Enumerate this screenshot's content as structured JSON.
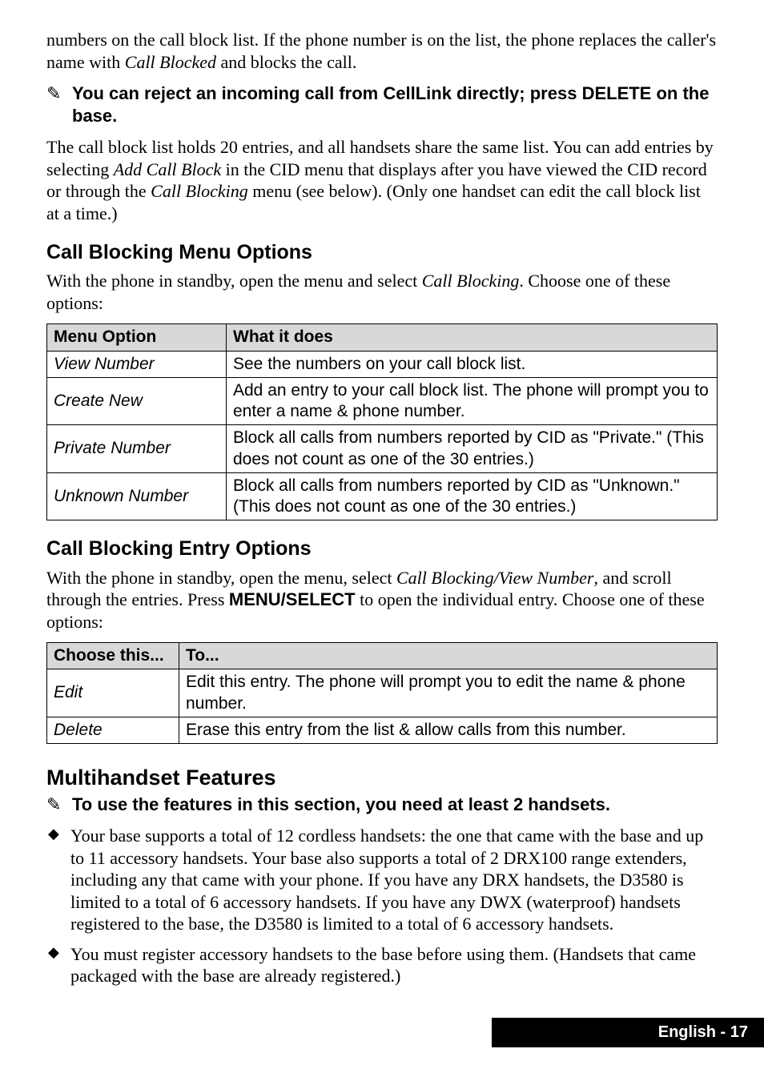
{
  "para1_pre": "numbers on the call block list. If the phone number is on the list, the phone replaces the caller's name with ",
  "para1_em": "Call Blocked",
  "para1_post": " and blocks the call.",
  "note1_icon": "✎",
  "note1_pre": "You can reject an incoming call from CellLink directly; press ",
  "note1_key": "DELETE",
  "note1_post": " on the base.",
  "para2_pre": "The call block list holds 20 entries, and all handsets share the same list. You can add entries by selecting ",
  "para2_em1": "Add Call Block",
  "para2_mid": " in the CID menu that displays after you have viewed the CID record or through the ",
  "para2_em2": "Call Blocking",
  "para2_post": " menu (see below). (Only one handset can edit the call block list at a time.)",
  "h_block_menu": "Call Blocking Menu Options",
  "para3_pre": "With the phone in standby, open the menu and select ",
  "para3_em": "Call Blocking",
  "para3_post": ". Choose one of these options:",
  "table1": {
    "headers": {
      "c1": "Menu Option",
      "c2": "What it does"
    },
    "rows": [
      {
        "opt": "View Number",
        "desc": "See the numbers on your call block list."
      },
      {
        "opt": "Create New",
        "desc": "Add an entry to your call block list. The phone will prompt you to enter a name & phone number."
      },
      {
        "opt": "Private Number",
        "desc": "Block all calls from numbers reported by CID as \"Private.\" (This does not count as one of the 30 entries.)"
      },
      {
        "opt": "Unknown Number",
        "desc": "Block all calls from numbers reported by CID as \"Unknown.\" (This does not count as one of the 30 entries.)"
      }
    ]
  },
  "h_block_entry": "Call Blocking Entry Options",
  "para4_pre": "With the phone in standby, open the menu, select ",
  "para4_em": "Call Blocking/View Number",
  "para4_mid": ", and scroll through the entries. Press ",
  "para4_key": "MENU/SELECT",
  "para4_post": " to open the individual entry. Choose one of these options:",
  "table2": {
    "headers": {
      "c1": "Choose this...",
      "c2": "To..."
    },
    "rows": [
      {
        "opt": "Edit",
        "desc": "Edit this entry. The phone will prompt you to edit the name & phone number."
      },
      {
        "opt": "Delete",
        "desc": "Erase this entry from the list & allow calls from this number."
      }
    ]
  },
  "h_multi": "Multihandset Features",
  "note2_icon": "✎",
  "note2_text": "To use the features in this section, you need at least 2 handsets.",
  "bullets": [
    "Your base supports a total of 12 cordless handsets: the one that came with the base and up to 11 accessory handsets. Your base also supports a total of 2 DRX100 range extenders, including any that came with your phone. If you have any DRX handsets, the D3580 is limited to a total of 6 accessory handsets. If you have any DWX (waterproof) handsets registered to the base, the D3580 is limited to a total of 6 accessory handsets.",
    "You must register accessory handsets to the base before using them. (Handsets that came packaged with the base are already registered.)"
  ],
  "footer": "English - 17"
}
